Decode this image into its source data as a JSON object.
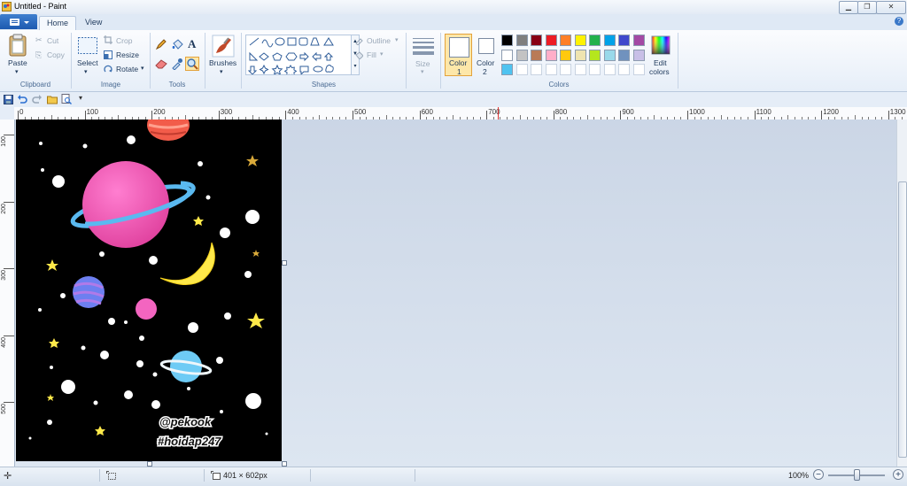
{
  "window": {
    "title": "Untitled - Paint"
  },
  "tabs": [
    {
      "label": "Home"
    },
    {
      "label": "View"
    }
  ],
  "ribbon": {
    "clipboard": {
      "label": "Clipboard",
      "paste": "Paste",
      "cut": "Cut",
      "copy": "Copy"
    },
    "image": {
      "label": "Image",
      "select": "Select",
      "crop": "Crop",
      "resize": "Resize",
      "rotate": "Rotate"
    },
    "tools": {
      "label": "Tools"
    },
    "brushes": {
      "label": "Brushes"
    },
    "shapes": {
      "label": "Shapes",
      "outline": "Outline",
      "fill": "Fill"
    },
    "size": {
      "label": "Size"
    },
    "colors": {
      "label": "Colors",
      "color1": "Color",
      "color1_num": "1",
      "color2": "Color",
      "color2_num": "2",
      "edit": "Edit",
      "edit2": "colors",
      "palette": [
        [
          "#000000",
          "#7f7f7f",
          "#880015",
          "#ed1c24",
          "#ff7f27",
          "#fff200",
          "#22b14c",
          "#00a2e8",
          "#3f48cc",
          "#a349a4"
        ],
        [
          "#ffffff",
          "#c3c3c3",
          "#b97a57",
          "#ffaec9",
          "#ffc90e",
          "#efe4b0",
          "#b5e61d",
          "#99d9ea",
          "#7092be",
          "#c8bfe7"
        ],
        [
          "#4fc3f0",
          "#ffffff",
          "#ffffff",
          "#ffffff",
          "#ffffff",
          "#ffffff",
          "#ffffff",
          "#ffffff",
          "#ffffff",
          "#ffffff"
        ]
      ]
    }
  },
  "ruler": {
    "top": [
      "0",
      "100",
      "200",
      "300",
      "400",
      "500",
      "600",
      "700",
      "800",
      "900",
      "1000",
      "1100",
      "1200",
      "1300"
    ],
    "left": [
      "100",
      "200",
      "300",
      "400",
      "500"
    ]
  },
  "canvas": {
    "watermark1": "@pekook",
    "watermark2": "#hoidap247"
  },
  "status": {
    "size": "401 × 602px",
    "zoom": "100%"
  }
}
